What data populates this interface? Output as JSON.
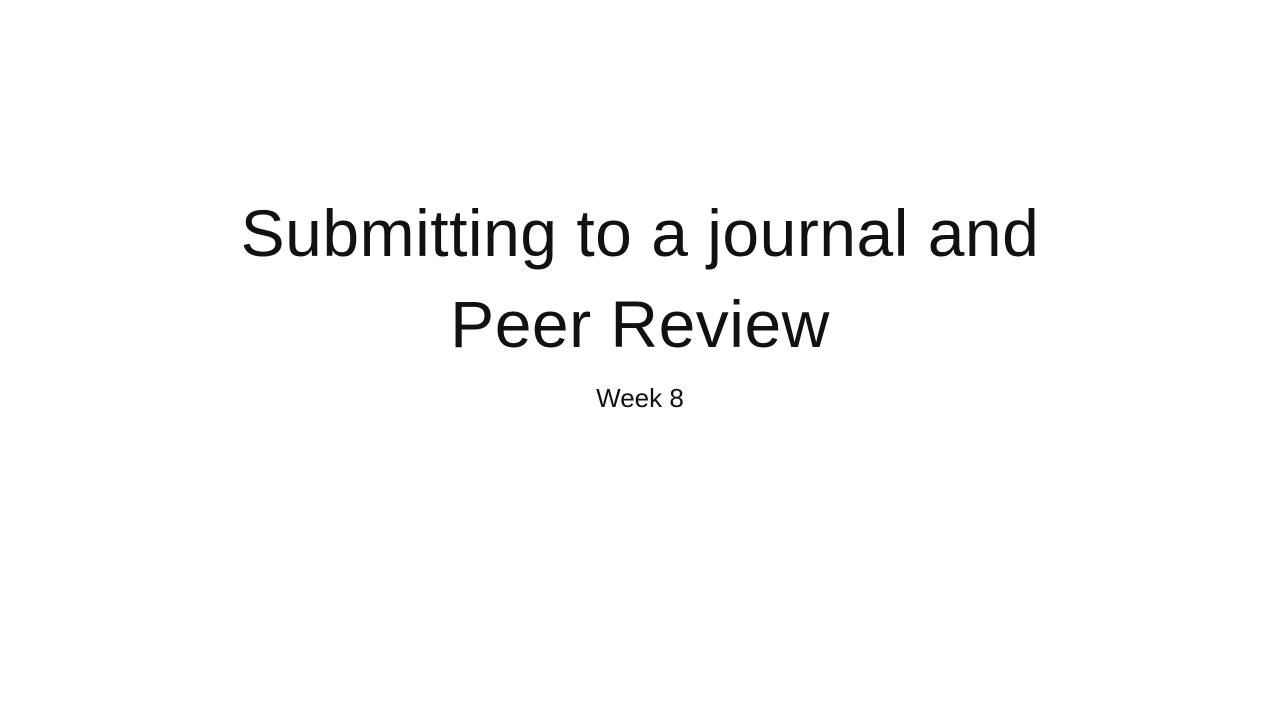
{
  "slide": {
    "title_line_1": "Submitting to a journal and",
    "title_line_2": "Peer Review",
    "subtitle": "Week 8"
  }
}
